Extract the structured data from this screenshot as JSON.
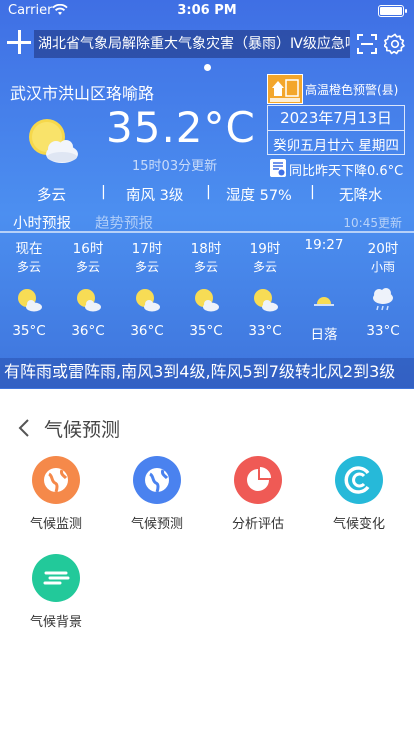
{
  "status_bar": {
    "carrier": "Carrier",
    "time": "3:06 PM"
  },
  "alert": {
    "text": "湖北省气象局解除重大气象灾害（暴雨）Ⅳ级应急响应"
  },
  "location": {
    "name": "武汉市洪山区珞喻路"
  },
  "warning": {
    "text": "高温橙色预警(县)",
    "color": "#f3a62c"
  },
  "current": {
    "temperature": "35.2°C",
    "updated": "15时03分更新",
    "date": "2023年7月13日",
    "lunar": "癸卯五月廿六 星期四",
    "compare": "同比昨天下降0.6°C"
  },
  "summary": {
    "weather": "多云",
    "wind": "南风 3级",
    "humidity": "湿度 57%",
    "rain": "无降水"
  },
  "tabs": {
    "hourly": "小时预报",
    "trend": "趋势预报",
    "updated": "10:45更新"
  },
  "hourly": [
    {
      "time": "现在",
      "weather": "多云",
      "icon": "partly-cloudy-icon",
      "temp": "35°C"
    },
    {
      "time": "16时",
      "weather": "多云",
      "icon": "partly-cloudy-icon",
      "temp": "36°C"
    },
    {
      "time": "17时",
      "weather": "多云",
      "icon": "partly-cloudy-icon",
      "temp": "36°C"
    },
    {
      "time": "18时",
      "weather": "多云",
      "icon": "partly-cloudy-icon",
      "temp": "35°C"
    },
    {
      "time": "19时",
      "weather": "多云",
      "icon": "partly-cloudy-icon",
      "temp": "33°C"
    },
    {
      "time": "19:27",
      "weather": "",
      "icon": "sunset-icon",
      "temp": "日落"
    },
    {
      "time": "20时",
      "weather": "小雨",
      "icon": "light-rain-icon",
      "temp": "33°C"
    }
  ],
  "ticker": {
    "text": "有阵雨或雷阵雨,南风3到4级,阵风5到7级转北风2到3级"
  },
  "climate": {
    "title": "气候预测",
    "items": [
      {
        "label": "气候监测",
        "icon": "globe-icon",
        "color": "#f5894a"
      },
      {
        "label": "气候预测",
        "icon": "globe-icon",
        "color": "#4a82ef"
      },
      {
        "label": "分析评估",
        "icon": "pie-chart-icon",
        "color": "#ef5a55"
      },
      {
        "label": "气候变化",
        "icon": "climate-change-icon",
        "color": "#26b9d9"
      },
      {
        "label": "气候背景",
        "icon": "wind-lines-icon",
        "color": "#22c99a"
      }
    ]
  }
}
